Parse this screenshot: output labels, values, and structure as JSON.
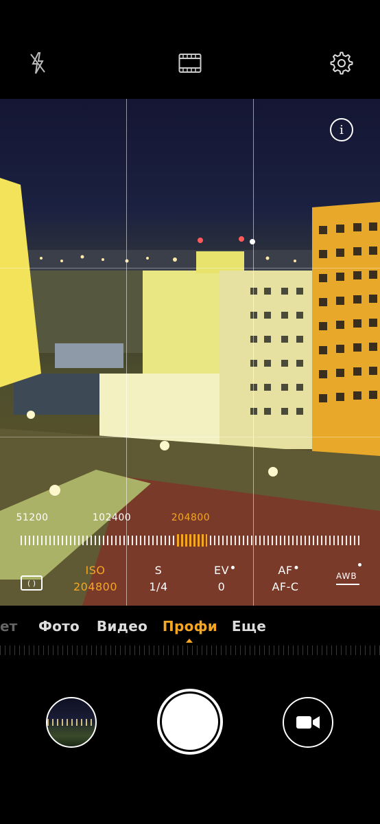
{
  "top_bar": {
    "icons": [
      "flash-off-icon",
      "film-icon",
      "settings-gear-icon"
    ]
  },
  "viewfinder": {
    "info_icon": "info-icon",
    "info_glyph": "i"
  },
  "iso_scale": {
    "labels": [
      "51200",
      "102400",
      "204800"
    ],
    "selected": "204800"
  },
  "pro_params": {
    "metering_glyph": "( )",
    "iso": {
      "name": "ISO",
      "value": "204800"
    },
    "shutter": {
      "name": "S",
      "value": "1/4"
    },
    "ev": {
      "name": "EV",
      "value": "0"
    },
    "af": {
      "name": "AF",
      "value": "AF-C"
    },
    "awb": {
      "name": "AWB"
    }
  },
  "modes": {
    "cut_off": "ет",
    "items": [
      "Фото",
      "Видео",
      "Профи",
      "Еще"
    ],
    "active": "Профи"
  },
  "bottom": {
    "gallery_thumb": "gallery-thumbnail",
    "shutter": "shutter-button",
    "video": "record-video-icon"
  },
  "colors": {
    "accent": "#f5a623",
    "background": "#000000"
  }
}
